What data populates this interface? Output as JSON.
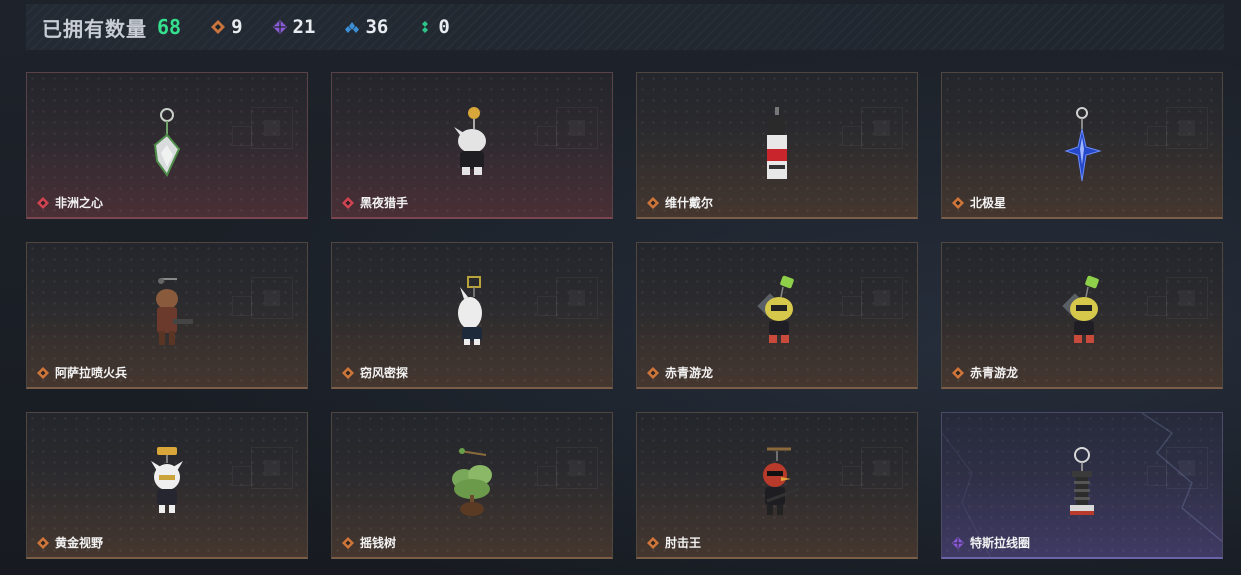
{
  "header": {
    "title": "已拥有数量",
    "total": "68",
    "stats": [
      {
        "icon": "orange-diamond-icon",
        "count": "9",
        "color": "#c8743c"
      },
      {
        "icon": "purple-diamond-icon",
        "count": "21",
        "color": "#8a5bd6"
      },
      {
        "icon": "blue-diamond-icon",
        "count": "36",
        "color": "#3c8fd8"
      },
      {
        "icon": "green-diamond-icon",
        "count": "0",
        "color": "#2fc48a"
      }
    ]
  },
  "colors": {
    "rarity_red": "#d0434f",
    "rarity_orange": "#d1763b",
    "rarity_purple": "#8a5bd6",
    "total_green": "#34e08e"
  },
  "items": [
    {
      "name": "非洲之心",
      "rarity": "red",
      "icon": "heart-of-africa-pendant-icon"
    },
    {
      "name": "黑夜猎手",
      "rarity": "red",
      "icon": "night-hunter-charm-icon"
    },
    {
      "name": "维什戴尔",
      "rarity": "orange",
      "icon": "wisadel-tag-icon"
    },
    {
      "name": "北极星",
      "rarity": "orange",
      "icon": "polaris-star-charm-icon"
    },
    {
      "name": "阿萨拉喷火兵",
      "rarity": "orange",
      "icon": "flamethrower-soldier-charm-icon"
    },
    {
      "name": "窃风密探",
      "rarity": "orange",
      "icon": "wind-spy-charm-icon"
    },
    {
      "name": "赤青游龙",
      "rarity": "orange",
      "icon": "dragon-chick-charm-icon"
    },
    {
      "name": "赤青游龙",
      "rarity": "orange",
      "icon": "dragon-chick-charm-icon"
    },
    {
      "name": "黄金视野",
      "rarity": "orange",
      "icon": "golden-vision-charm-icon"
    },
    {
      "name": "摇钱树",
      "rarity": "orange",
      "icon": "money-tree-charm-icon"
    },
    {
      "name": "肘击王",
      "rarity": "orange",
      "icon": "elbow-king-charm-icon"
    },
    {
      "name": "特斯拉线圈",
      "rarity": "purple",
      "icon": "tesla-coil-charm-icon"
    }
  ]
}
